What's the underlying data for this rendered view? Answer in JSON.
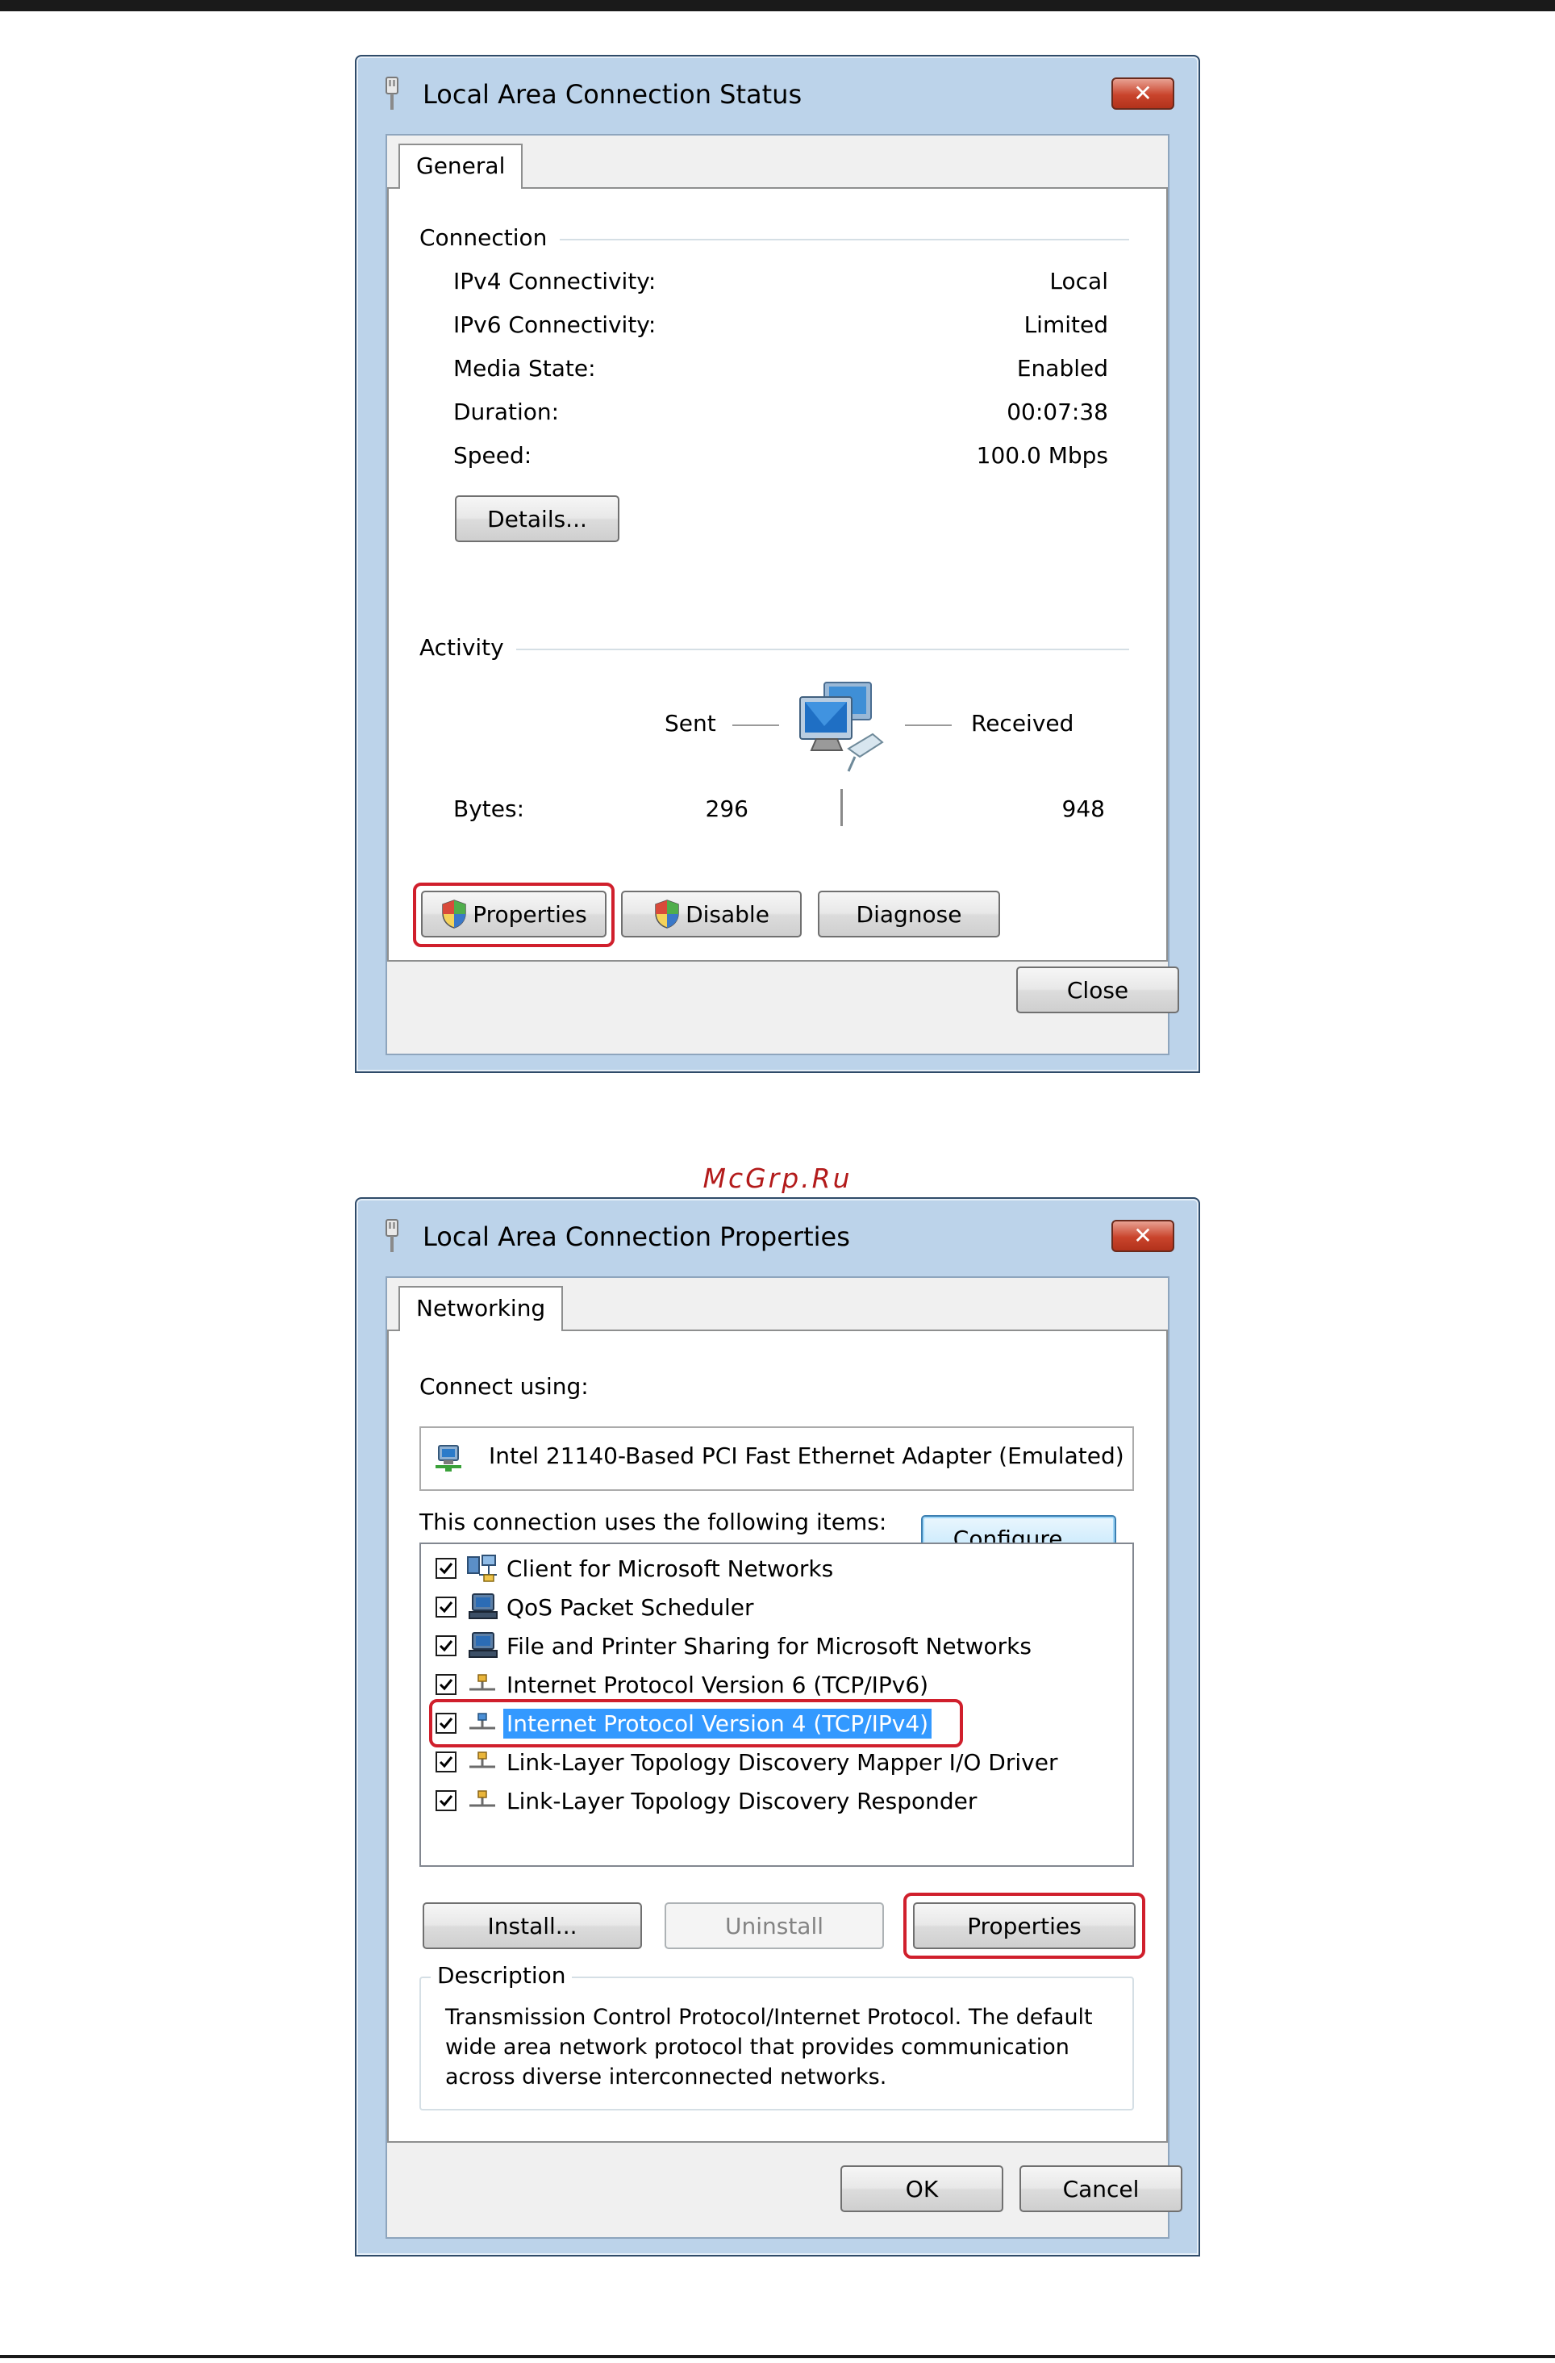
{
  "watermark": "McGrp.Ru",
  "status_window": {
    "title": "Local Area Connection Status",
    "close_glyph": "✕",
    "tab": "General",
    "connection_label": "Connection",
    "rows": [
      {
        "label": "IPv4 Connectivity:",
        "value": "Local"
      },
      {
        "label": "IPv6 Connectivity:",
        "value": "Limited"
      },
      {
        "label": "Media State:",
        "value": "Enabled"
      },
      {
        "label": "Duration:",
        "value": "00:07:38"
      },
      {
        "label": "Speed:",
        "value": "100.0 Mbps"
      }
    ],
    "details_button": "Details...",
    "activity_label": "Activity",
    "sent_label": "Sent",
    "received_label": "Received",
    "bytes_label": "Bytes:",
    "bytes_sent": "296",
    "bytes_received": "948",
    "buttons": {
      "properties": "Properties",
      "disable": "Disable",
      "diagnose": "Diagnose"
    },
    "close_button": "Close"
  },
  "properties_window": {
    "title": "Local Area Connection Properties",
    "close_glyph": "✕",
    "tab": "Networking",
    "connect_using_label": "Connect using:",
    "adapter_name": "Intel 21140-Based PCI Fast Ethernet Adapter (Emulated)",
    "configure_button": "Configure...",
    "items_label": "This connection uses the following items:",
    "items": [
      {
        "label": "Client for Microsoft Networks",
        "checked": true,
        "icon": "client-network-icon"
      },
      {
        "label": "QoS Packet Scheduler",
        "checked": true,
        "icon": "service-computer-icon"
      },
      {
        "label": "File and Printer Sharing for Microsoft Networks",
        "checked": true,
        "icon": "service-computer-icon"
      },
      {
        "label": "Internet Protocol Version 6 (TCP/IPv6)",
        "checked": true,
        "icon": "protocol-icon"
      },
      {
        "label": "Internet Protocol Version 4 (TCP/IPv4)",
        "checked": true,
        "icon": "protocol-icon",
        "selected": true
      },
      {
        "label": "Link-Layer Topology Discovery Mapper I/O Driver",
        "checked": true,
        "icon": "protocol-icon"
      },
      {
        "label": "Link-Layer Topology Discovery Responder",
        "checked": true,
        "icon": "protocol-icon"
      }
    ],
    "install_button": "Install...",
    "uninstall_button": "Uninstall",
    "properties_button": "Properties",
    "description_label": "Description",
    "description_text": "Transmission Control Protocol/Internet Protocol. The default wide area network protocol that provides communication across diverse interconnected networks.",
    "ok_button": "OK",
    "cancel_button": "Cancel"
  },
  "colors": {
    "highlight": "#d01f2c",
    "selection": "#3399ff",
    "window_frame": "#bcd3ea"
  }
}
